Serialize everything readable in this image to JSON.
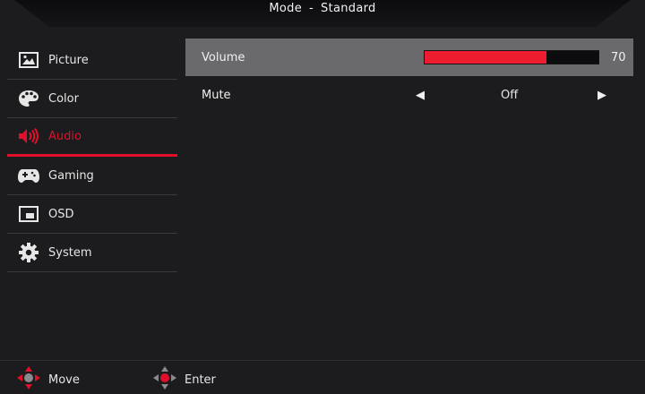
{
  "header": {
    "mode_label": "Mode",
    "separator": "-",
    "mode_value": "Standard"
  },
  "sidebar": {
    "items": [
      {
        "label": "Picture",
        "icon": "picture-icon",
        "active": false
      },
      {
        "label": "Color",
        "icon": "palette-icon",
        "active": false
      },
      {
        "label": "Audio",
        "icon": "speaker-icon",
        "active": true
      },
      {
        "label": "Gaming",
        "icon": "gamepad-icon",
        "active": false
      },
      {
        "label": "OSD",
        "icon": "osd-window-icon",
        "active": false
      },
      {
        "label": "System",
        "icon": "gear-icon",
        "active": false
      }
    ]
  },
  "audio": {
    "volume": {
      "label": "Volume",
      "value": "70",
      "level_percent": 70
    },
    "mute": {
      "label": "Mute",
      "value": "Off"
    }
  },
  "footer": {
    "move_label": "Move",
    "enter_label": "Enter"
  },
  "colors": {
    "accent": "#e0102a",
    "bar_fill": "#ed1c2e",
    "selected_row": "#6a6a6d",
    "background": "#1c1c1e"
  }
}
